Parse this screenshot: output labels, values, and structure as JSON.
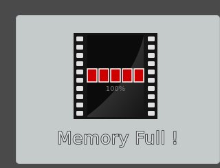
{
  "dialog": {
    "icon": "film-strip-memory-icon",
    "progress_percent": 100,
    "progress_label": "100%",
    "progress_segments": 5,
    "message": "Memory Full !"
  },
  "colors": {
    "background": "#4a4a4a",
    "dialog": "#c5cbcb",
    "film": "#151515",
    "perforation": "#e2e2e2",
    "segment_fill": "#cc0000",
    "progress_text": "#7a7a7a"
  }
}
